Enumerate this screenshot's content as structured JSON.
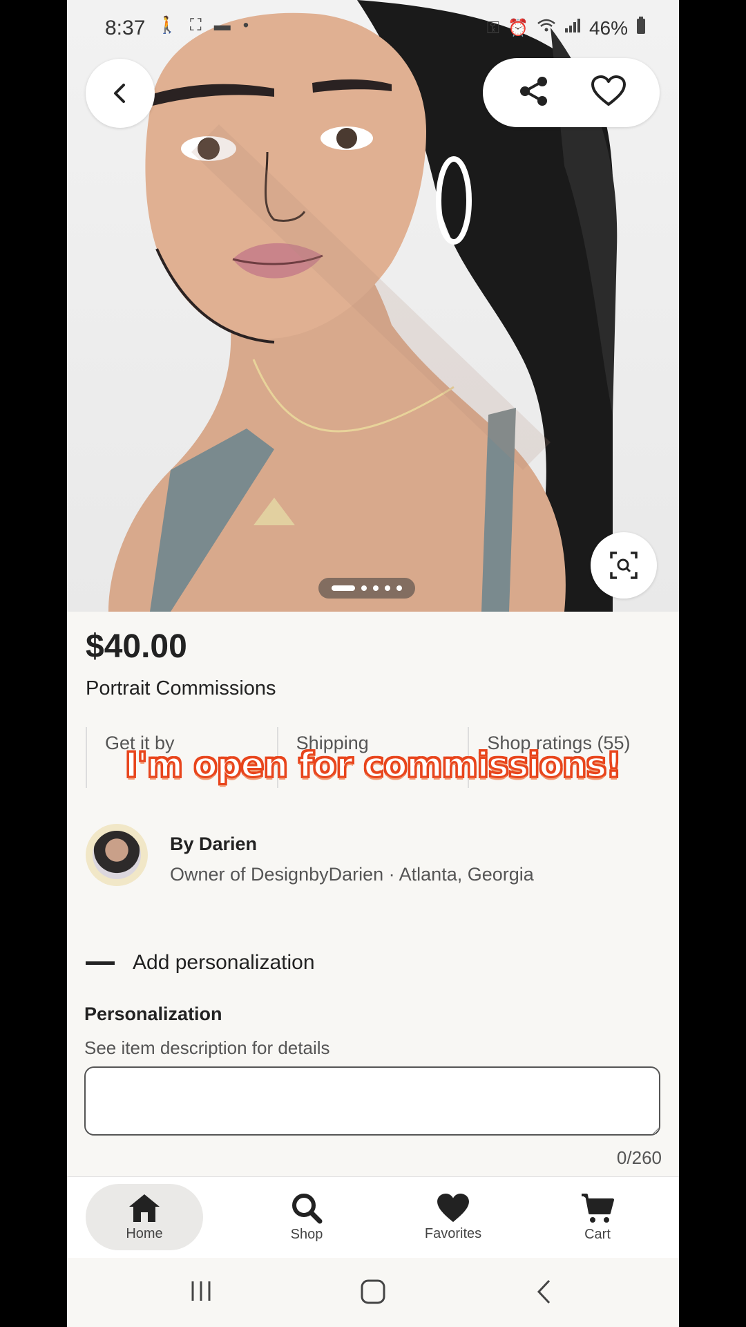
{
  "status_bar": {
    "time": "8:37",
    "battery": "46%"
  },
  "icons": {
    "back": "chevron-left-icon",
    "share": "share-icon",
    "favorite": "heart-outline-icon",
    "zoom": "image-search-icon"
  },
  "product": {
    "price": "$40.00",
    "title": "Portrait Commissions"
  },
  "info_row": [
    {
      "label": "Get it by"
    },
    {
      "label": "Shipping"
    },
    {
      "label": "Shop ratings (55)"
    }
  ],
  "overlay_caption": "I'm open for commissions!",
  "seller": {
    "name": "By Darien",
    "subtitle": "Owner of DesignbyDarien · Atlanta, Georgia"
  },
  "personalization": {
    "toggle_label": "Add personalization",
    "heading": "Personalization",
    "description": "See item description for details",
    "input_value": "",
    "counter": "0/260"
  },
  "bottom_nav": [
    {
      "label": "Home",
      "icon": "home-icon",
      "active": true
    },
    {
      "label": "Shop",
      "icon": "search-icon",
      "active": false
    },
    {
      "label": "Favorites",
      "icon": "heart-icon",
      "active": false
    },
    {
      "label": "Cart",
      "icon": "cart-icon",
      "active": false
    }
  ],
  "colors": {
    "caption_text": "#ffffff",
    "caption_outline": "#e8451c",
    "background": "#f8f7f4"
  }
}
